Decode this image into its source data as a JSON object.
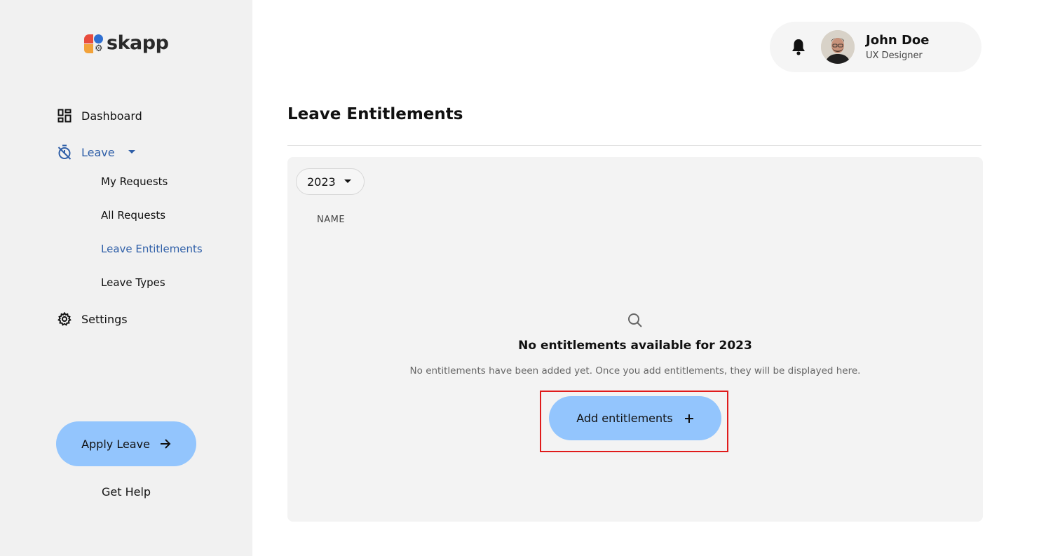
{
  "brand": {
    "name": "skapp"
  },
  "sidebar": {
    "items": [
      {
        "label": "Dashboard",
        "icon": "dashboard-icon"
      },
      {
        "label": "Leave",
        "icon": "timer-off-icon"
      },
      {
        "label": "Settings",
        "icon": "gear-icon"
      }
    ],
    "leave_sub": [
      {
        "label": "My Requests"
      },
      {
        "label": "All Requests"
      },
      {
        "label": "Leave Entitlements"
      },
      {
        "label": "Leave Types"
      }
    ],
    "apply_label": "Apply Leave",
    "help_label": "Get Help"
  },
  "user": {
    "name": "John Doe",
    "role": "UX Designer"
  },
  "main": {
    "title": "Leave Entitlements",
    "year": "2023",
    "column_name": "NAME",
    "empty_title": "No entitlements available for 2023",
    "empty_desc": "No entitlements have been added yet. Once you add entitlements, they will be displayed here.",
    "add_label": "Add entitlements"
  },
  "colors": {
    "accent": "#93c5fd",
    "active_text": "#2f5fa8",
    "highlight": "#e01b1b"
  }
}
